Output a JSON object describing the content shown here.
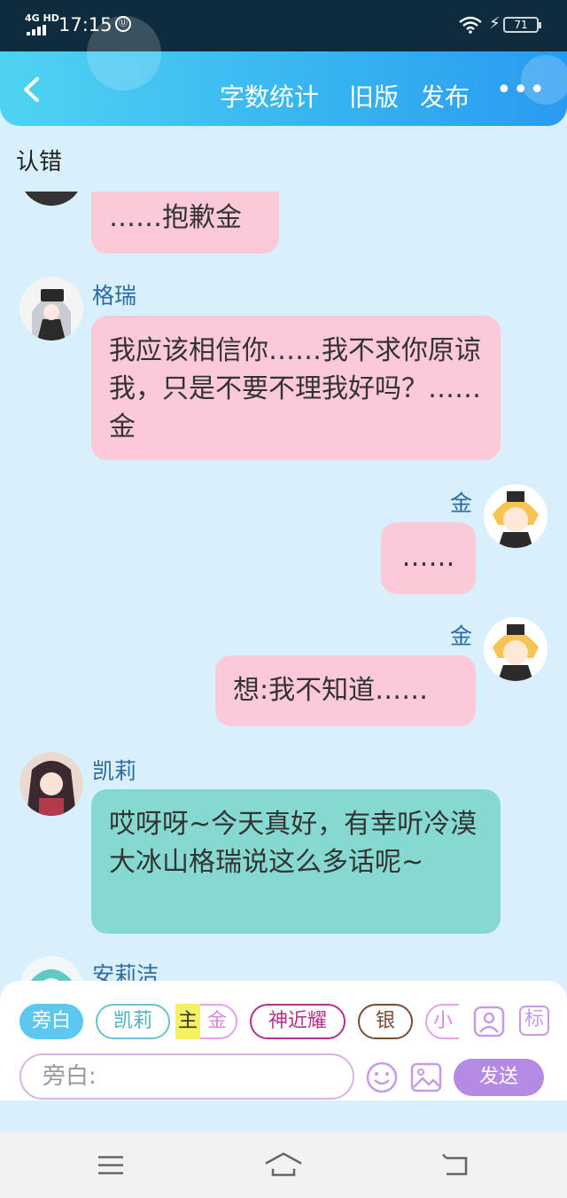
{
  "status_bar": {
    "network": "4G HD",
    "time": "17:15",
    "battery": "71"
  },
  "header": {
    "actions": [
      "字数统计",
      "旧版",
      "发布"
    ]
  },
  "title": "认错",
  "messages": [
    {
      "text": "……抱歉金"
    },
    {
      "name": "格瑞",
      "text": "我应该相信你……我不求你原谅我，只是不要不理我好吗？……金"
    },
    {
      "name": "金",
      "text": "……"
    },
    {
      "name": "金",
      "text": "想:我不知道……"
    },
    {
      "name": "凯莉",
      "text": "哎呀呀~今天真好，有幸听冷漠大冰山格瑞说这么多话呢~"
    },
    {
      "name": "安莉洁"
    }
  ],
  "composer": {
    "roles": [
      "旁白",
      "凯莉",
      "金",
      "神近耀",
      "银",
      "小"
    ],
    "main_tag": "主",
    "icon_label": "标",
    "input_placeholder": "旁白:",
    "send_label": "发送"
  },
  "colors": {
    "header": "#36b2f0",
    "bubble_pink": "#fbc9d7",
    "bubble_teal": "#86d9d1",
    "name": "#2c6ba3",
    "send": "#b58ae3"
  }
}
